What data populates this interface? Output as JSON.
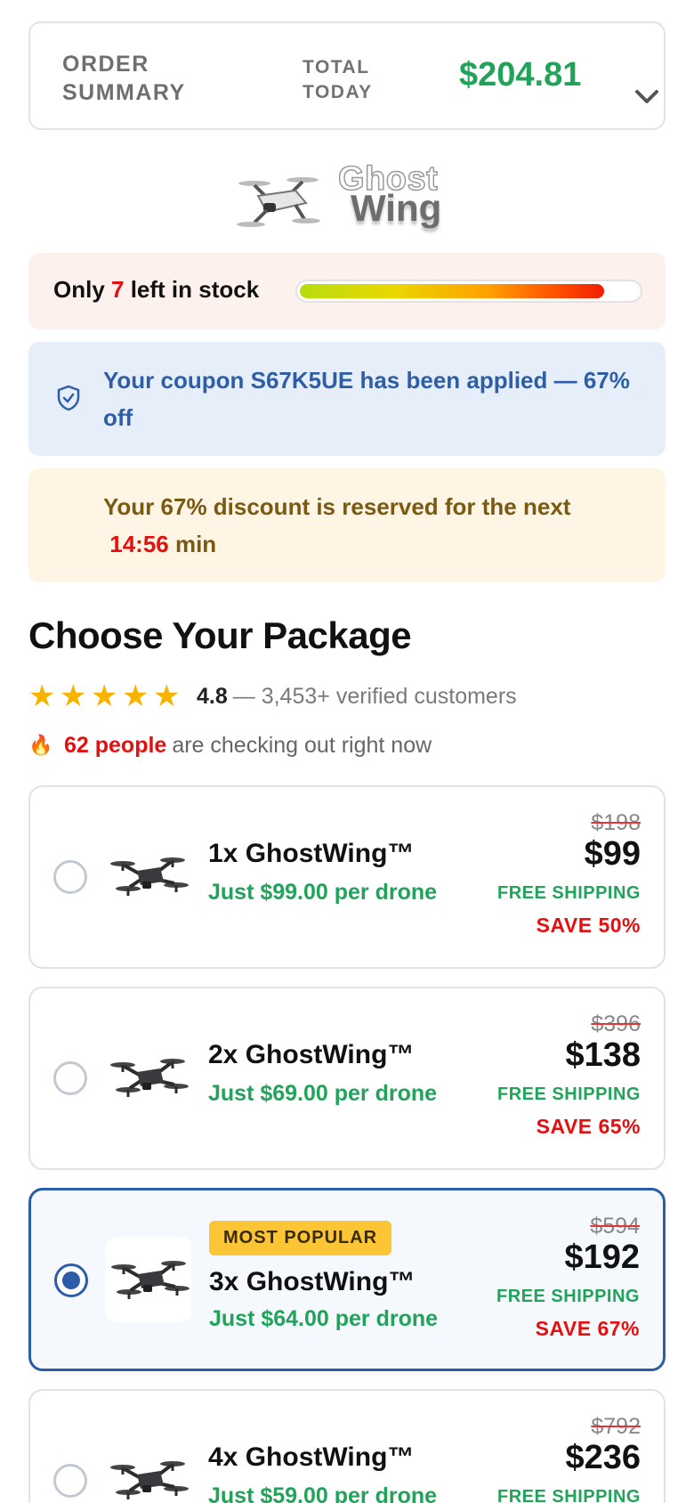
{
  "summary": {
    "label": "ORDER SUMMARY",
    "total_label": "TOTAL TODAY",
    "total_amount": "$204.81",
    "toggle_icon": "chevron-down-icon"
  },
  "logo": {
    "line1": "Ghost",
    "line2": "Wing"
  },
  "stock": {
    "prefix": "Only ",
    "count": "7",
    "suffix": " left in stock",
    "level_percent": 90
  },
  "coupon": {
    "icon": "shield-check-icon",
    "text": "Your coupon S67K5UE has been applied — 67% off"
  },
  "timer": {
    "text": "Your 67% discount is reserved for the next",
    "time": "14:56",
    "unit": "min"
  },
  "packages_section": {
    "heading": "Choose Your Package",
    "rating": {
      "stars": 5,
      "score": "4.8",
      "verified": "— 3,453+ verified customers"
    },
    "live": {
      "icon": "fire-icon",
      "people": "62 people",
      "rest": "are checking out right now"
    }
  },
  "packages": [
    {
      "name": "1x GhostWing™",
      "per": "Just $99.00 per drone",
      "old_price": "$198",
      "price": "$99",
      "shipping": "FREE SHIPPING",
      "save": "SAVE 50%",
      "badge": "",
      "selected": false
    },
    {
      "name": "2x GhostWing™",
      "per": "Just $69.00 per drone",
      "old_price": "$396",
      "price": "$138",
      "shipping": "FREE SHIPPING",
      "save": "SAVE 65%",
      "badge": "",
      "selected": false
    },
    {
      "name": "3x GhostWing™",
      "per": "Just $64.00 per drone",
      "old_price": "$594",
      "price": "$192",
      "shipping": "FREE SHIPPING",
      "save": "SAVE 67%",
      "badge": "MOST POPULAR",
      "selected": true
    },
    {
      "name": "4x GhostWing™",
      "per": "Just $59.00 per drone",
      "old_price": "$792",
      "price": "$236",
      "shipping": "FREE SHIPPING",
      "save": "",
      "badge": "",
      "selected": false
    }
  ],
  "colors": {
    "accent_green": "#21a35a",
    "alert_red": "#e60f0f",
    "selected_blue": "#2b5ca8",
    "coupon_blue": "#2e5fa6",
    "badge_yellow": "#fcc535"
  }
}
